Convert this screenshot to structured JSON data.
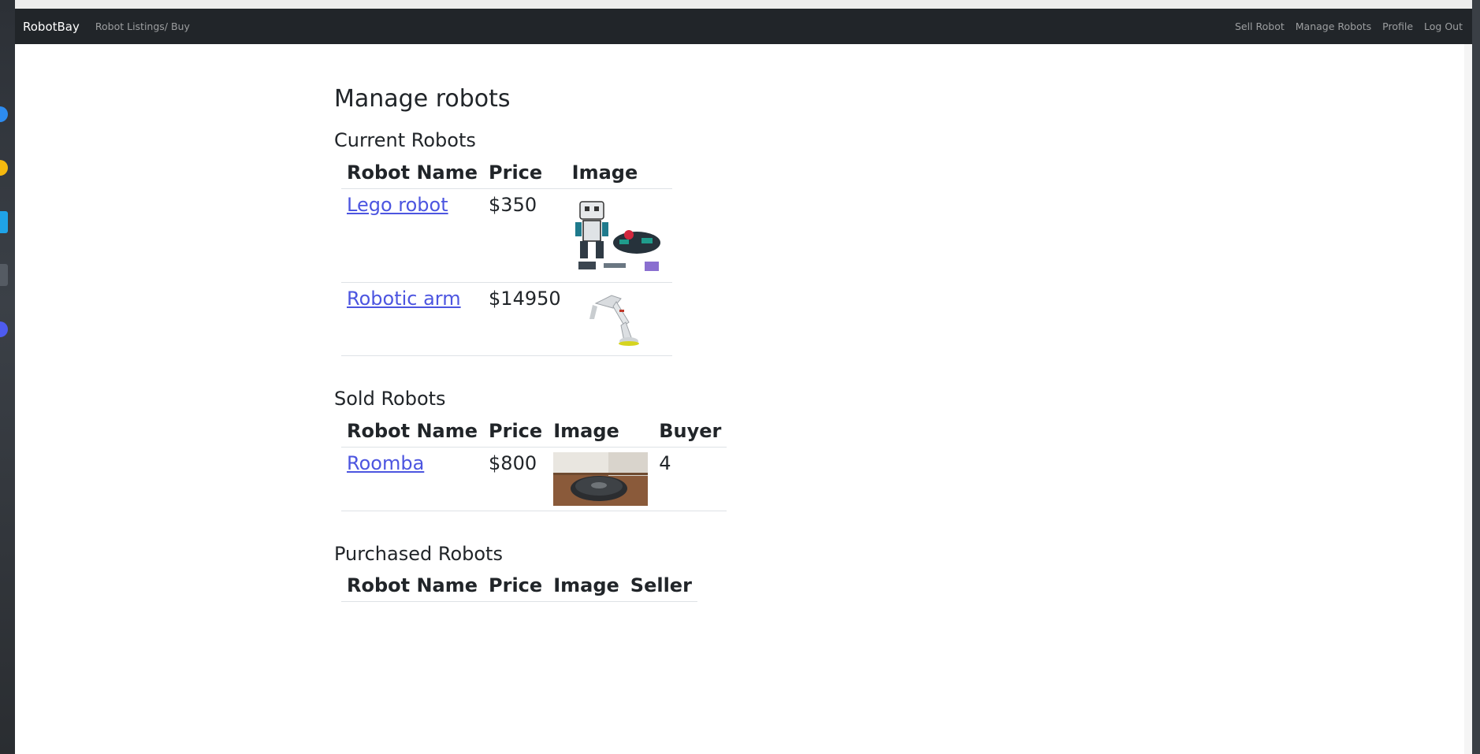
{
  "nav": {
    "brand": "RobotBay",
    "listings": "Robot Listings/ Buy",
    "sell": "Sell Robot",
    "manage": "Manage Robots",
    "profile": "Profile",
    "logout": "Log Out"
  },
  "page": {
    "title": "Manage robots"
  },
  "current": {
    "heading": "Current Robots",
    "headers": [
      "Robot Name",
      "Price",
      "Image"
    ],
    "rows": [
      {
        "name": "Lego robot",
        "price": "$350",
        "image": "lego-robot-kit"
      },
      {
        "name": "Robotic arm",
        "price": "$14950",
        "image": "robotic-arm"
      }
    ]
  },
  "sold": {
    "heading": "Sold Robots",
    "headers": [
      "Robot Name",
      "Price",
      "Image",
      "Buyer"
    ],
    "rows": [
      {
        "name": "Roomba",
        "price": "$800",
        "image": "roomba-photo",
        "buyer": "4"
      }
    ]
  },
  "purchased": {
    "heading": "Purchased Robots",
    "headers": [
      "Robot Name",
      "Price",
      "Image",
      "Seller"
    ]
  },
  "colors": {
    "navbar": "#212529",
    "link": "#4c55e0",
    "text": "#212529"
  }
}
